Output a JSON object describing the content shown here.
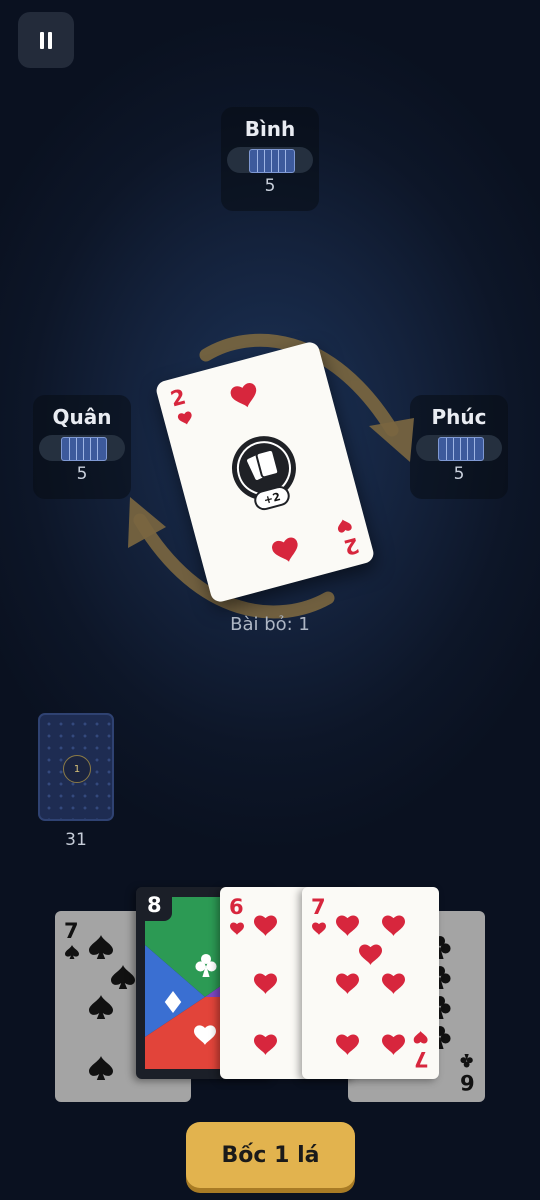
{
  "players": [
    {
      "name": "Bình",
      "count": "5"
    },
    {
      "name": "Quân",
      "count": "5"
    },
    {
      "name": "Phúc",
      "count": "5"
    }
  ],
  "center": {
    "card": {
      "rank": "2",
      "suit": "heart",
      "action_badge": "+2"
    },
    "discard_label": "Bài bỏ: 1"
  },
  "deck": {
    "badge": "1",
    "count": "31"
  },
  "hand": [
    {
      "rank": "7",
      "suit": "spade",
      "dimmed": true
    },
    {
      "rank": "8",
      "type": "wild",
      "suit": "club"
    },
    {
      "rank": "6",
      "suit": "heart"
    },
    {
      "rank": "7",
      "suit": "heart"
    },
    {
      "rank": "6",
      "suit": "club",
      "dimmed": true
    }
  ],
  "actions": {
    "draw_label": "Bốc 1 lá"
  },
  "colors": {
    "background": "#0d1628",
    "panel": "#080c14",
    "heart_red": "#d7263d",
    "draw_button": "#e2b34e",
    "direction_arrow": "#7a6640",
    "wild_green": "#2c9a54",
    "wild_blue": "#3a6fd2",
    "wild_red": "#e2443a",
    "wild_purple": "#7d47c4"
  },
  "icons": [
    "pause-icon",
    "direction-arrows-icon",
    "draw-two-icon",
    "heart-icon",
    "spade-icon",
    "club-icon",
    "diamond-icon"
  ]
}
